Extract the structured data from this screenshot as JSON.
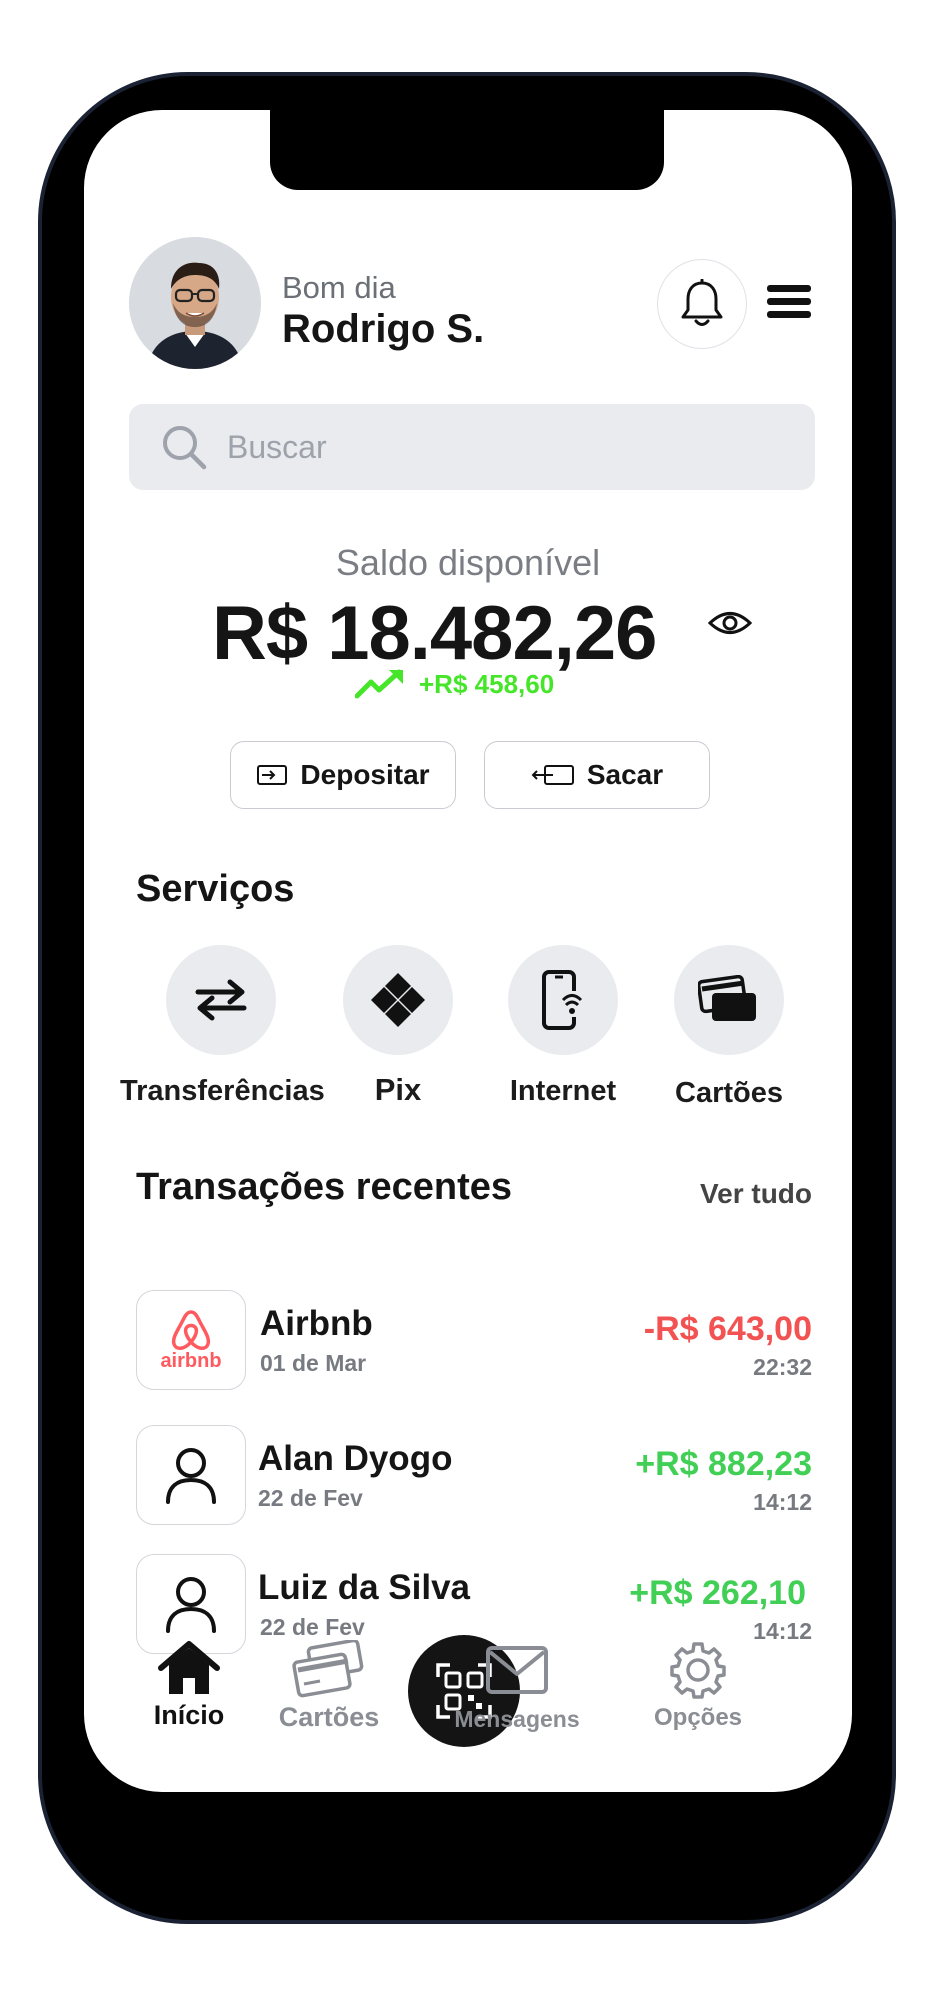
{
  "header": {
    "greeting": "Bom dia",
    "username": "Rodrigo S.",
    "avatar_icon": "user-avatar-photo",
    "notifications_icon": "bell-icon",
    "menu_icon": "hamburger-menu-icon"
  },
  "search": {
    "placeholder": "Buscar",
    "icon": "search-icon"
  },
  "balance": {
    "label": "Saldo disponível",
    "amount": "R$ 18.482,26",
    "visibility_icon": "eye-icon",
    "change": "+R$ 458,60",
    "change_color": "#45e629"
  },
  "actions": {
    "deposit_label": "Depositar",
    "withdraw_label": "Sacar"
  },
  "services": {
    "title": "Serviços",
    "items": [
      {
        "label": "Transferências",
        "icon": "arrows-swap-icon"
      },
      {
        "label": "Pix",
        "icon": "pix-icon"
      },
      {
        "label": "Internet",
        "icon": "phone-wifi-icon"
      },
      {
        "label": "Cartões",
        "icon": "cards-icon"
      }
    ]
  },
  "transactions": {
    "title": "Transações recentes",
    "see_all": "Ver tudo",
    "items": [
      {
        "name": "Airbnb",
        "date": "01 de Mar",
        "amount": "-R$ 643,00",
        "time": "22:32",
        "logo_text": "airbnb",
        "type": "debit"
      },
      {
        "name": "Alan Dyogo",
        "date": "22 de Fev",
        "amount": "+R$ 882,23",
        "time": "14:12",
        "type": "credit"
      },
      {
        "name": "Luiz da Silva",
        "date": "22 de Fev",
        "amount": "+R$ 262,10",
        "time": "14:12",
        "type": "credit"
      }
    ]
  },
  "nav": {
    "items": [
      {
        "label": "Início",
        "icon": "home-icon",
        "active": true
      },
      {
        "label": "Cartões",
        "icon": "cards-icon"
      },
      {
        "label": "",
        "icon": "qr-code-icon"
      },
      {
        "label": "Mensagens",
        "icon": "mail-icon"
      },
      {
        "label": "Opções",
        "icon": "gear-icon"
      }
    ]
  },
  "colors": {
    "negative": "#f25252",
    "positive": "#41cf55",
    "airbnb": "#ff5a5f"
  }
}
